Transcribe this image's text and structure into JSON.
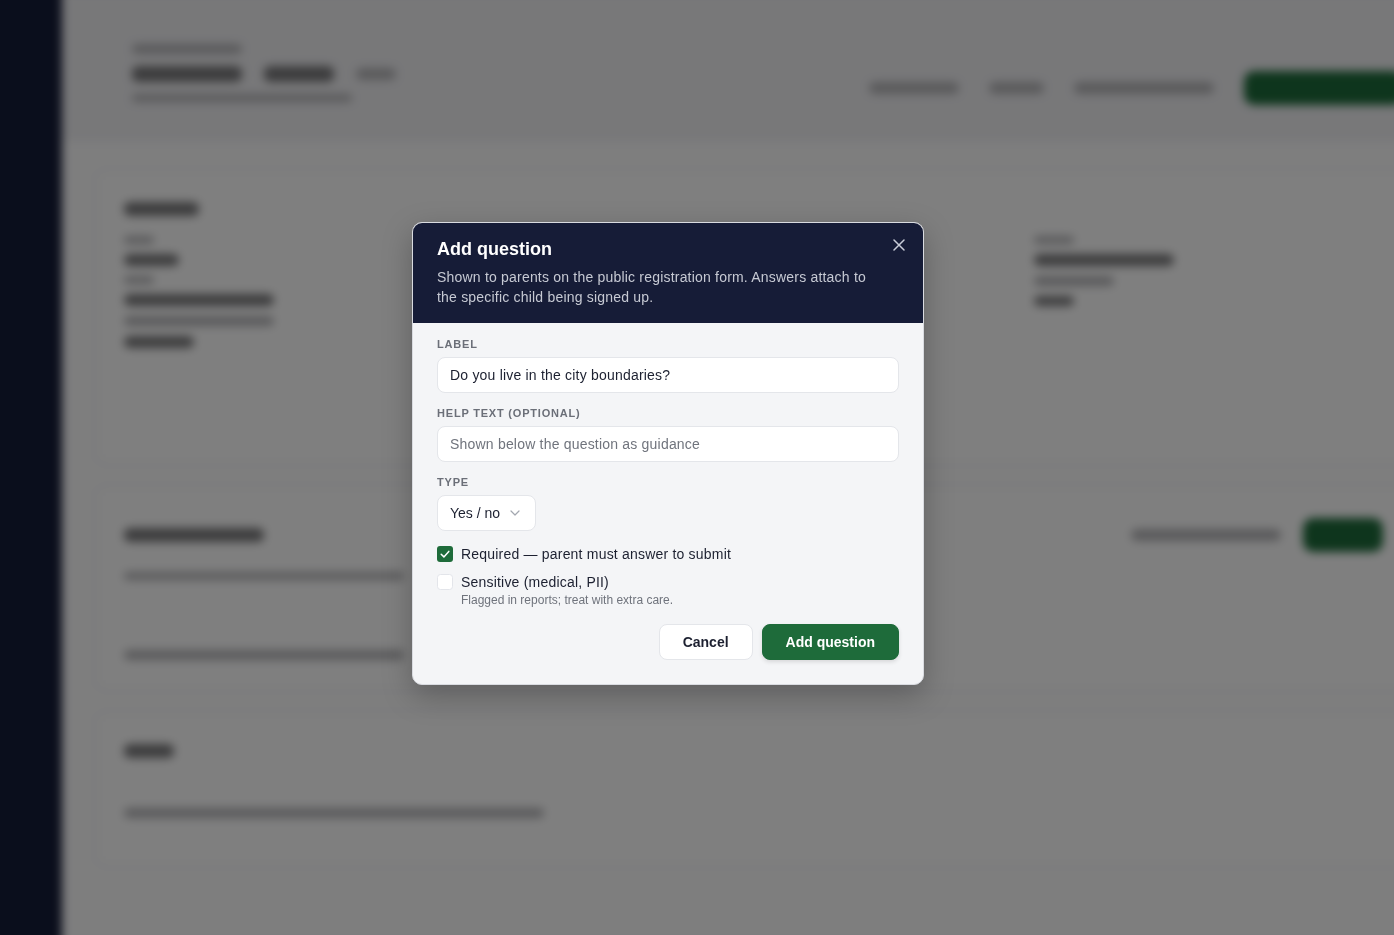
{
  "modal": {
    "title": "Add question",
    "description": "Shown to parents on the public registration form. Answers attach to the specific child being signed up."
  },
  "fields": [
    {
      "kind": "text",
      "label": "LABEL",
      "value": "Do you live in the city boundaries?"
    },
    {
      "kind": "text",
      "label": "HELP TEXT (OPTIONAL)",
      "placeholder": "Shown below the question as guidance"
    },
    {
      "kind": "select",
      "label": "TYPE",
      "value": "Yes / no"
    }
  ],
  "options": [
    {
      "label": "Required — parent must answer to submit",
      "checked": true
    },
    {
      "label": "Sensitive (medical, PII)",
      "checked": false,
      "hint": "Flagged in reports; treat with extra care."
    }
  ],
  "buttons": [
    {
      "kind": "secondary",
      "label": "Cancel"
    },
    {
      "kind": "primary",
      "label": "Add question"
    }
  ]
}
